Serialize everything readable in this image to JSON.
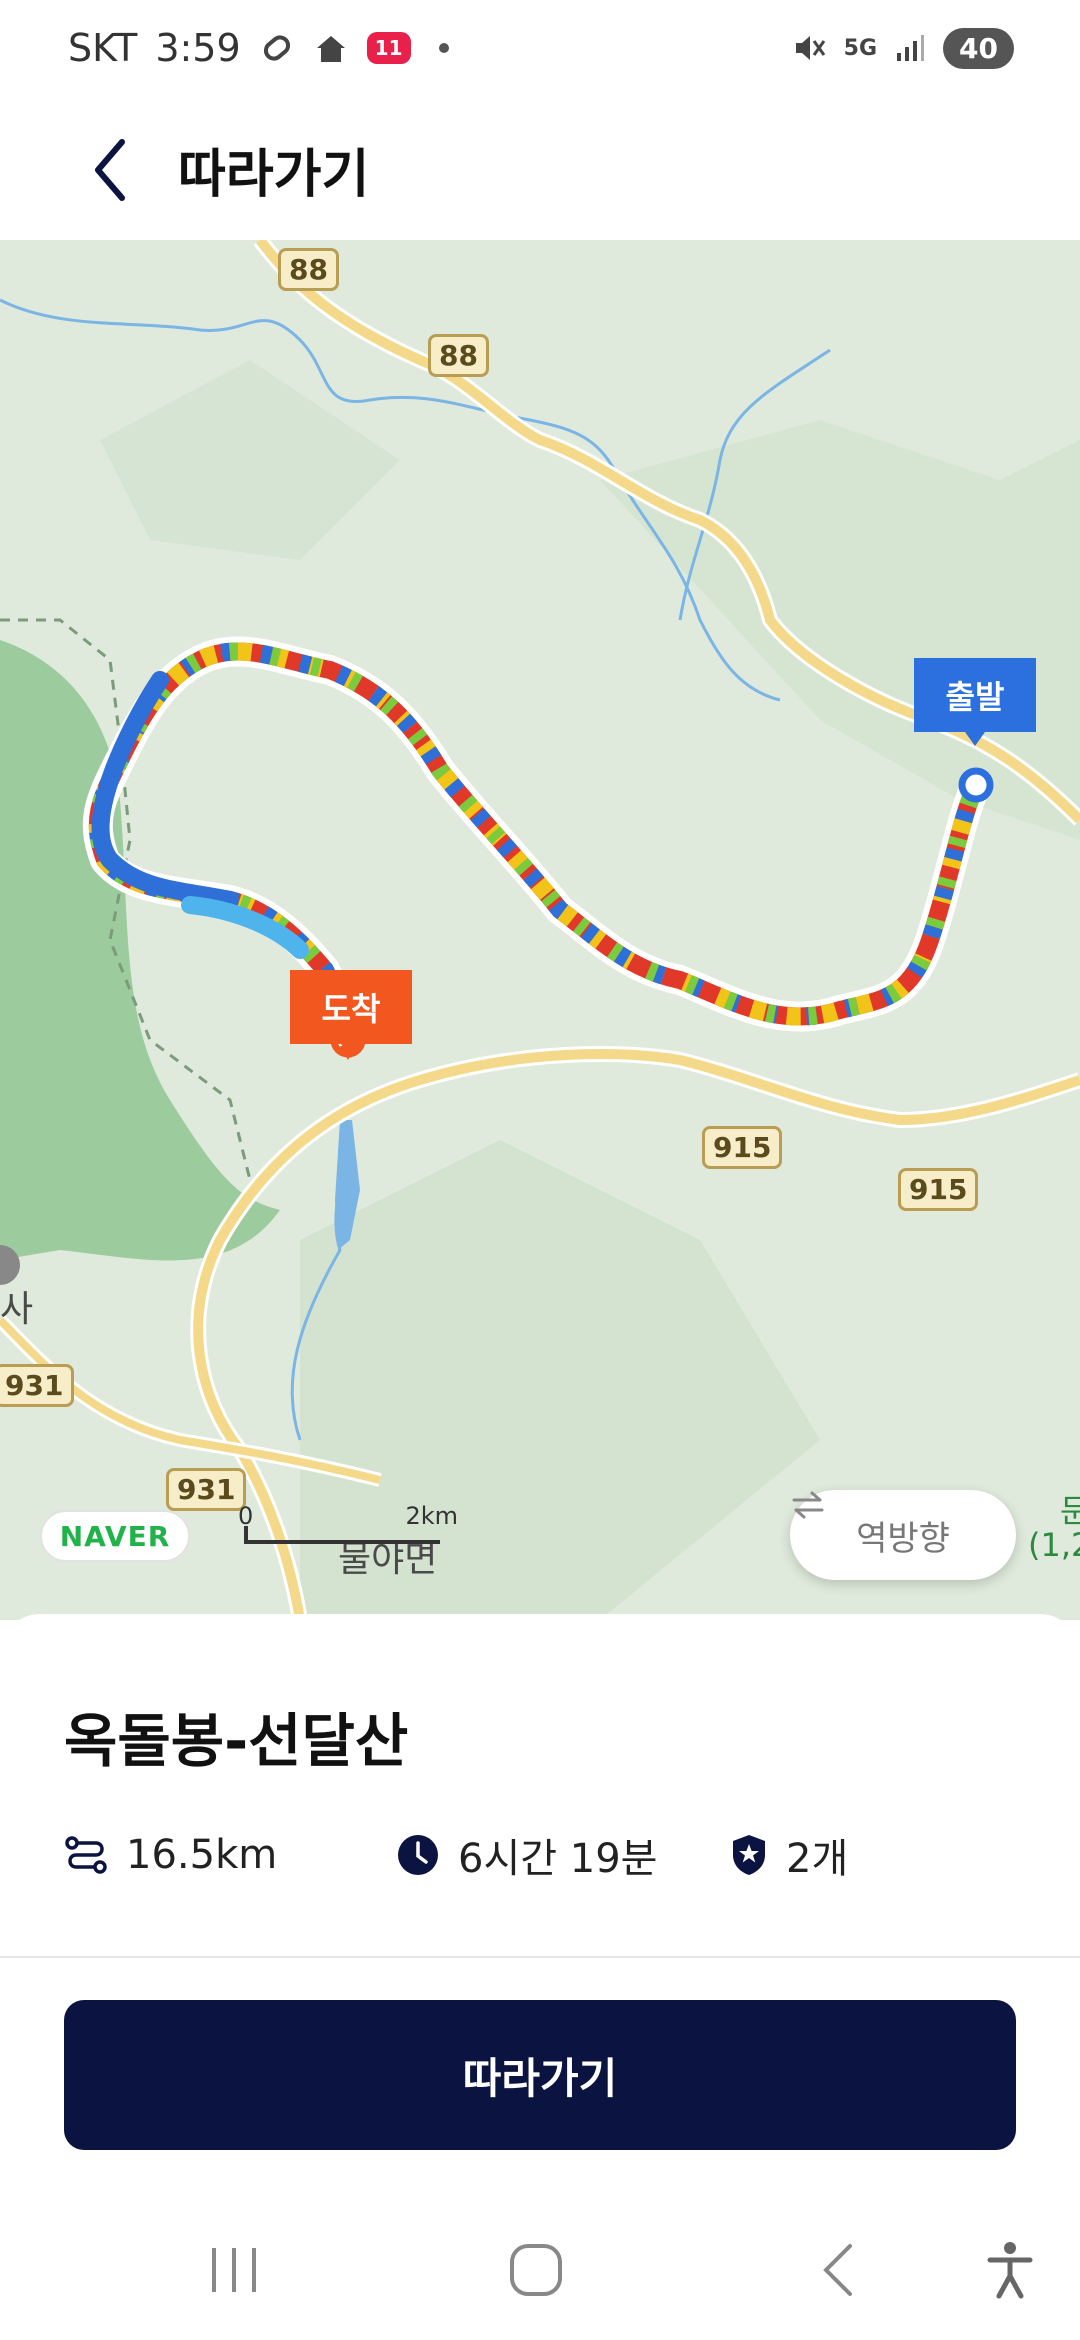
{
  "status_bar": {
    "carrier": "SKT",
    "time": "3:59",
    "app_badge": "11",
    "network": "5G",
    "battery": "40"
  },
  "header": {
    "title": "따라가기"
  },
  "map": {
    "route_shields": [
      "88",
      "88",
      "915",
      "915",
      "931",
      "931"
    ],
    "place_label": "물야면",
    "edge_label_left": "사",
    "edge_label_right_1": "문",
    "edge_label_right_2": "(1,2",
    "start_marker": "출발",
    "end_marker": "도착",
    "provider_logo": "NAVER",
    "scale_zero": "0",
    "scale_max": "2km",
    "reverse_button": "역방향",
    "colors": {
      "start": "#2c6fde",
      "end": "#f2571f",
      "road": "#f5d98a",
      "water": "#7ab5e6"
    }
  },
  "course": {
    "name": "옥돌봉-선달산",
    "distance": "16.5km",
    "duration": "6시간 19분",
    "badges": "2개"
  },
  "actions": {
    "follow_button": "따라가기"
  },
  "colors": {
    "primary": "#0b1340"
  }
}
